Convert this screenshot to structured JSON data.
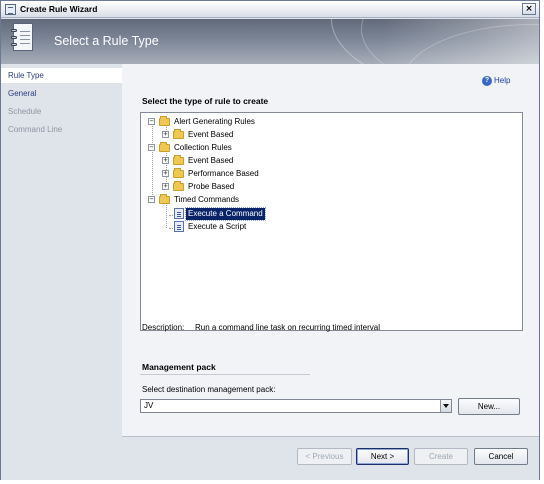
{
  "window": {
    "title": "Create Rule Wizard",
    "close_glyph": "×"
  },
  "banner": {
    "title": "Select a Rule Type"
  },
  "steps": [
    {
      "label": "Rule Type",
      "state": "active"
    },
    {
      "label": "General",
      "state": "enabled"
    },
    {
      "label": "Schedule",
      "state": "disabled"
    },
    {
      "label": "Command Line",
      "state": "disabled"
    }
  ],
  "help": {
    "label": "Help",
    "icon": "help-icon"
  },
  "rule_section": {
    "heading": "Select the type of rule to create"
  },
  "tree": [
    {
      "label": "Alert Generating Rules",
      "icon": "folder-icon",
      "expander": "−",
      "level": 0
    },
    {
      "label": "Event Based",
      "icon": "folder-icon",
      "expander": "+",
      "level": 1
    },
    {
      "label": "Collection Rules",
      "icon": "folder-icon",
      "expander": "−",
      "level": 0
    },
    {
      "label": "Event Based",
      "icon": "folder-icon",
      "expander": "+",
      "level": 1
    },
    {
      "label": "Performance Based",
      "icon": "folder-icon",
      "expander": "+",
      "level": 1
    },
    {
      "label": "Probe Based",
      "icon": "folder-icon",
      "expander": "+",
      "level": 1
    },
    {
      "label": "Timed Commands",
      "icon": "folder-icon",
      "expander": "−",
      "level": 0
    },
    {
      "label": "Execute a Command",
      "icon": "command-icon",
      "level": 1,
      "selected": true
    },
    {
      "label": "Execute a Script",
      "icon": "command-icon",
      "level": 1
    }
  ],
  "description": {
    "label": "Description:",
    "text": "Run a command line task on recurring timed interval"
  },
  "management_pack": {
    "heading": "Management pack",
    "select_label": "Select destination management pack:",
    "selected_value": "JV",
    "new_button": "New..."
  },
  "footer_buttons": {
    "previous": "< Previous",
    "next": "Next >",
    "create": "Create",
    "cancel": "Cancel"
  }
}
